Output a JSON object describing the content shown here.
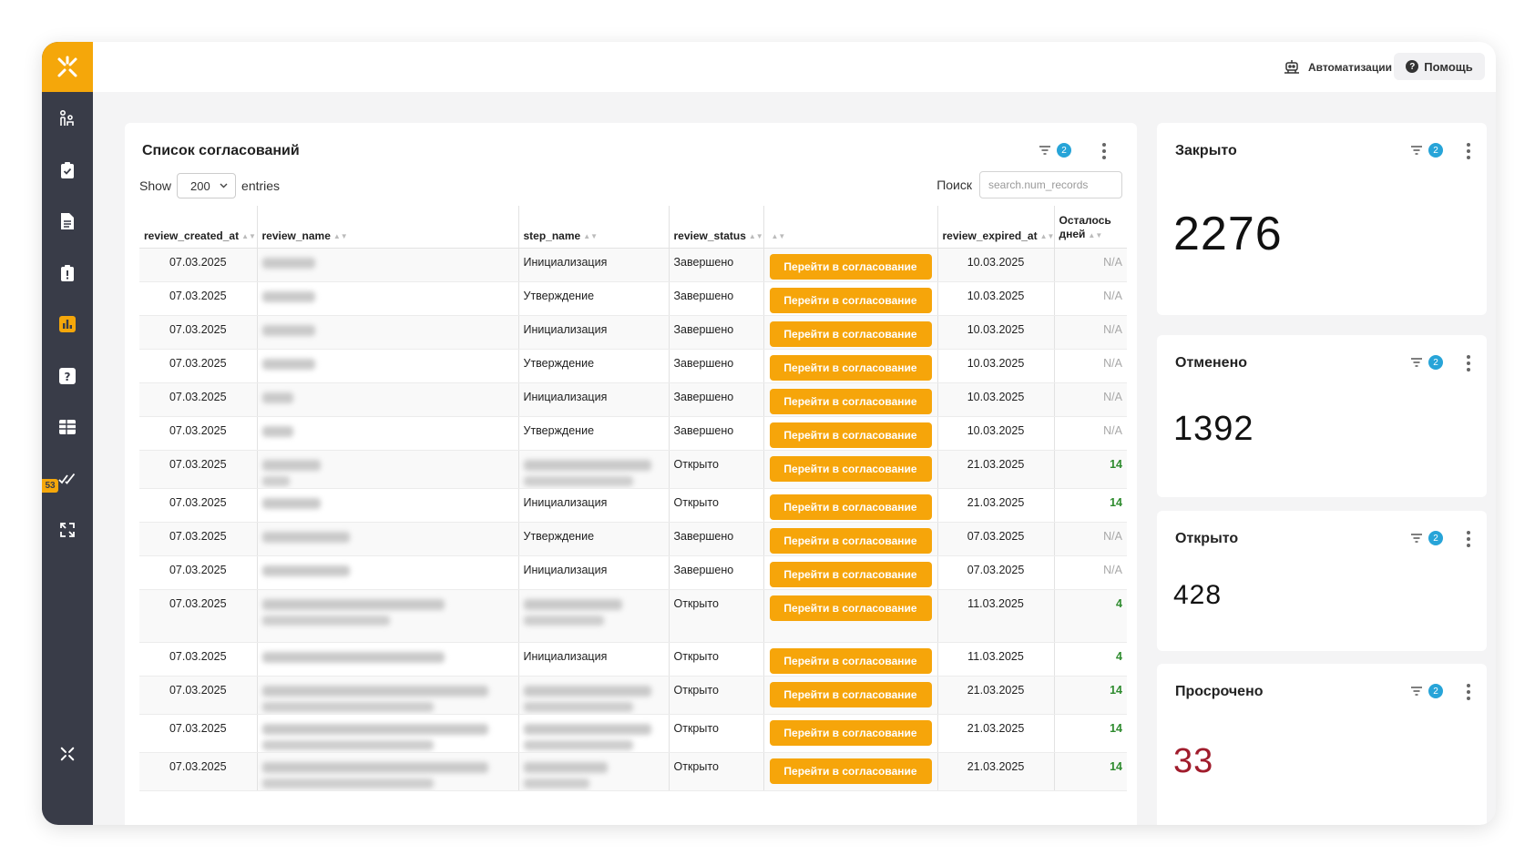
{
  "topbar": {
    "automations_label": "Автоматизации",
    "help_label": "Помощь"
  },
  "sidebar": {
    "badge": "53",
    "icons": [
      "people-icon",
      "clipboard-check-icon",
      "document-icon",
      "clipboard-alert-icon",
      "bar-chart-icon",
      "question-icon",
      "grid-icon",
      "checkmarks-icon",
      "refresh-icon"
    ]
  },
  "table_card": {
    "title": "Список согласований",
    "filter_count": "2",
    "show_label": "Show",
    "show_value": "200",
    "entries_label": "entries",
    "search_label": "Поиск",
    "search_placeholder": "search.num_records",
    "columns": [
      "review_created_at",
      "review_name",
      "step_name",
      "review_status",
      "",
      "review_expired_at",
      "Осталось дней"
    ],
    "rows": [
      {
        "created": "07.03.2025",
        "step": "Инициализация",
        "status": "Завершено",
        "button": "Перейти в согласование",
        "expired": "10.03.2025",
        "days": "N/A"
      },
      {
        "created": "07.03.2025",
        "step": "Утверждение",
        "status": "Завершено",
        "button": "Перейти в согласование",
        "expired": "10.03.2025",
        "days": "N/A"
      },
      {
        "created": "07.03.2025",
        "step": "Инициализация",
        "status": "Завершено",
        "button": "Перейти в согласование",
        "expired": "10.03.2025",
        "days": "N/A"
      },
      {
        "created": "07.03.2025",
        "step": "Утверждение",
        "status": "Завершено",
        "button": "Перейти в согласование",
        "expired": "10.03.2025",
        "days": "N/A"
      },
      {
        "created": "07.03.2025",
        "step": "Инициализация",
        "status": "Завершено",
        "button": "Перейти в согласование",
        "expired": "10.03.2025",
        "days": "N/A"
      },
      {
        "created": "07.03.2025",
        "step": "Утверждение",
        "status": "Завершено",
        "button": "Перейти в согласование",
        "expired": "10.03.2025",
        "days": "N/A"
      },
      {
        "created": "07.03.2025",
        "step": "",
        "status": "Открыто",
        "button": "Перейти в согласование",
        "expired": "21.03.2025",
        "days": "14"
      },
      {
        "created": "07.03.2025",
        "step": "Инициализация",
        "status": "Открыто",
        "button": "Перейти в согласование",
        "expired": "21.03.2025",
        "days": "14"
      },
      {
        "created": "07.03.2025",
        "step": "Утверждение",
        "status": "Завершено",
        "button": "Перейти в согласование",
        "expired": "07.03.2025",
        "days": "N/A"
      },
      {
        "created": "07.03.2025",
        "step": "Инициализация",
        "status": "Завершено",
        "button": "Перейти в согласование",
        "expired": "07.03.2025",
        "days": "N/A"
      },
      {
        "created": "07.03.2025",
        "step": "",
        "status": "Открыто",
        "button": "Перейти в согласование",
        "expired": "11.03.2025",
        "days": "4"
      },
      {
        "created": "07.03.2025",
        "step": "Инициализация",
        "status": "Открыто",
        "button": "Перейти в согласование",
        "expired": "11.03.2025",
        "days": "4"
      },
      {
        "created": "07.03.2025",
        "step": "",
        "status": "Открыто",
        "button": "Перейти в согласование",
        "expired": "21.03.2025",
        "days": "14"
      },
      {
        "created": "07.03.2025",
        "step": "",
        "status": "Открыто",
        "button": "Перейти в согласование",
        "expired": "21.03.2025",
        "days": "14"
      },
      {
        "created": "07.03.2025",
        "step": "",
        "status": "Открыто",
        "button": "Перейти в согласование",
        "expired": "21.03.2025",
        "days": "14"
      }
    ]
  },
  "kpis": [
    {
      "title": "Закрыто",
      "value": "2276",
      "filter_count": "2",
      "color": "#111111"
    },
    {
      "title": "Отменено",
      "value": "1392",
      "filter_count": "2",
      "color": "#111111"
    },
    {
      "title": "Открыто",
      "value": "428",
      "filter_count": "2",
      "color": "#111111"
    },
    {
      "title": "Просрочено",
      "value": "33",
      "filter_count": "2",
      "color": "#a01c2c"
    }
  ]
}
